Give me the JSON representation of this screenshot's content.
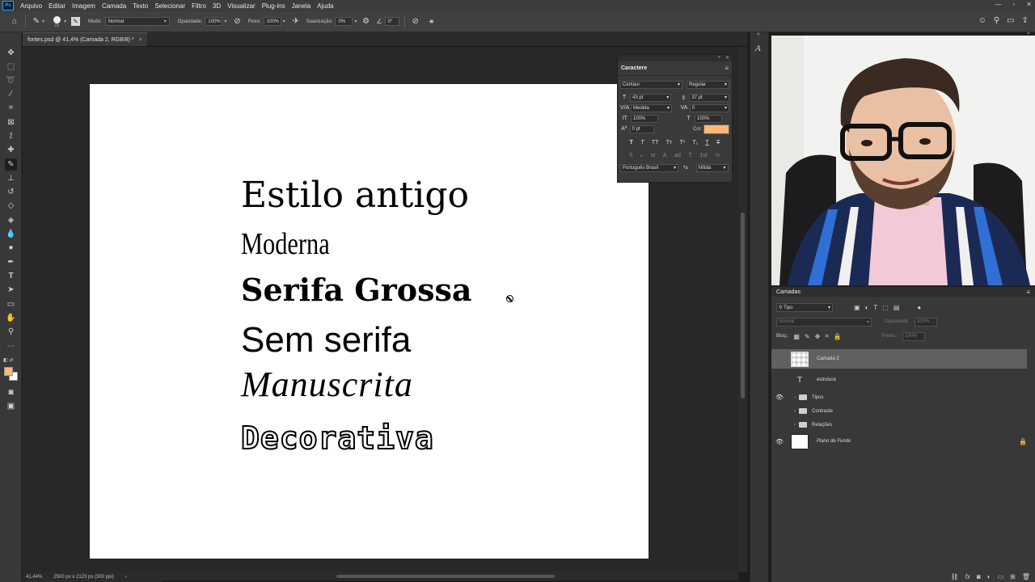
{
  "menubar": {
    "logo": "Ps",
    "items": [
      "Arquivo",
      "Editar",
      "Imagem",
      "Camada",
      "Texto",
      "Selecionar",
      "Filtro",
      "3D",
      "Visualizar",
      "Plug-ins",
      "Janela",
      "Ajuda"
    ],
    "window_controls": [
      "—",
      "▫",
      "✕"
    ]
  },
  "options": {
    "brush_size": "23",
    "mode_label": "Modo:",
    "mode_value": "Normal",
    "opacity_label": "Opacidade:",
    "opacity_value": "100%",
    "flow_label": "Fluxo:",
    "flow_value": "100%",
    "smoothing_label": "Suavização:",
    "smoothing_value": "0%",
    "angle_value": "0°"
  },
  "document": {
    "tab_title": "fontes.psd @ 41,4% (Camada 2, RGB/8) *",
    "tab_close": "×",
    "zoom": "41,44%",
    "doc_size": "2500 px x 2123 px (300 ppi)",
    "status_arrow": "›"
  },
  "artboard": {
    "lines": [
      "Estilo antigo",
      "Moderna",
      "Serifa Grossa",
      "Sem serifa",
      "Manuscrita",
      "Decorativa"
    ]
  },
  "character": {
    "title": "Caractere",
    "font_family": "Centaur",
    "font_style": "Regular",
    "size": "43 pt",
    "leading": "37 pt",
    "kerning": "Medida",
    "tracking": "0",
    "vscale": "100%",
    "hscale": "100%",
    "baseline": "0 pt",
    "color_label": "Cor:",
    "color": "#fdb876",
    "style_buttons": [
      "T",
      "T",
      "TT",
      "Tт",
      "T¹",
      "T₁",
      "T",
      "T"
    ],
    "opentype_buttons": [
      "fi",
      "ℴ",
      "st",
      "A",
      "ad",
      "T",
      "1st",
      "½"
    ],
    "language": "Português Brasil",
    "aa_label": "ªa",
    "antialias": "Nítida"
  },
  "layers": {
    "title": "Camadas",
    "filter_kind": "Tipo",
    "blend_mode": "Normal",
    "opacity_label": "Opacidade:",
    "opacity_value": "100%",
    "lock_label": "Bloq.:",
    "fill_label": "Preen.:",
    "fill_value": "100%",
    "items": [
      {
        "name": "Camada 2",
        "type": "pixel",
        "visible": false,
        "selected": true
      },
      {
        "name": "estrutura",
        "type": "text",
        "visible": false,
        "selected": false
      },
      {
        "name": "Tipos",
        "type": "group",
        "visible": true,
        "selected": false
      },
      {
        "name": "Contraste",
        "type": "group",
        "visible": false,
        "selected": false
      },
      {
        "name": "Relações",
        "type": "group",
        "visible": false,
        "selected": false
      },
      {
        "name": "Plano de Fundo",
        "type": "background",
        "visible": true,
        "selected": false
      }
    ],
    "footer_icons": [
      "link-icon",
      "fx-icon",
      "mask-icon",
      "adjustment-icon",
      "group-icon",
      "new-layer-icon",
      "trash-icon"
    ]
  },
  "colors": {
    "foreground": "#fdb876",
    "background": "#ffffff",
    "accent": "#31a8ff"
  }
}
